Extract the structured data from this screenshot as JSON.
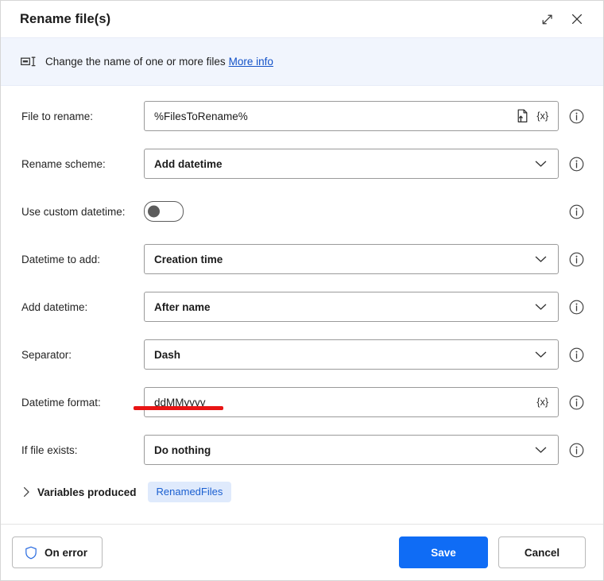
{
  "window": {
    "title": "Rename file(s)",
    "expand_icon": "expand-diagonal-icon",
    "close_icon": "close-icon"
  },
  "banner": {
    "icon": "rename-text-icon",
    "text": "Change the name of one or more files",
    "link_label": "More info",
    "background": "#f1f5fd",
    "link_color": "#1352c8"
  },
  "form": {
    "rows": [
      {
        "label": "File to rename:",
        "type": "text",
        "value": "%FilesToRename%",
        "has_file_picker": true,
        "has_variable_button": true,
        "variable_label": "{x}"
      },
      {
        "label": "Rename scheme:",
        "type": "select",
        "value": "Add datetime"
      },
      {
        "label": "Use custom datetime:",
        "type": "toggle",
        "value": "Off",
        "checked": false
      },
      {
        "label": "Datetime to add:",
        "type": "select",
        "value": "Creation time"
      },
      {
        "label": "Add datetime:",
        "type": "select",
        "value": "After name"
      },
      {
        "label": "Separator:",
        "type": "select",
        "value": "Dash"
      },
      {
        "label": "Datetime format:",
        "type": "text",
        "value": "ddMMyyyy",
        "has_file_picker": false,
        "has_variable_button": true,
        "variable_label": "{x}",
        "annotated": true
      },
      {
        "label": "If file exists:",
        "type": "select",
        "value": "Do nothing"
      }
    ],
    "info_icon": "info-circle-icon"
  },
  "variables": {
    "chevron_icon": "chevron-right-icon",
    "title": "Variables produced",
    "chips": [
      "RenamedFiles"
    ],
    "chip_bg": "#dfeafc",
    "chip_color": "#1a5fd0"
  },
  "footer": {
    "on_error_label": "On error",
    "on_error_icon": "shield-icon",
    "save_label": "Save",
    "cancel_label": "Cancel",
    "primary_color": "#0f6cf5"
  },
  "annotation": {
    "color": "#e81414",
    "target": "Datetime format value"
  }
}
